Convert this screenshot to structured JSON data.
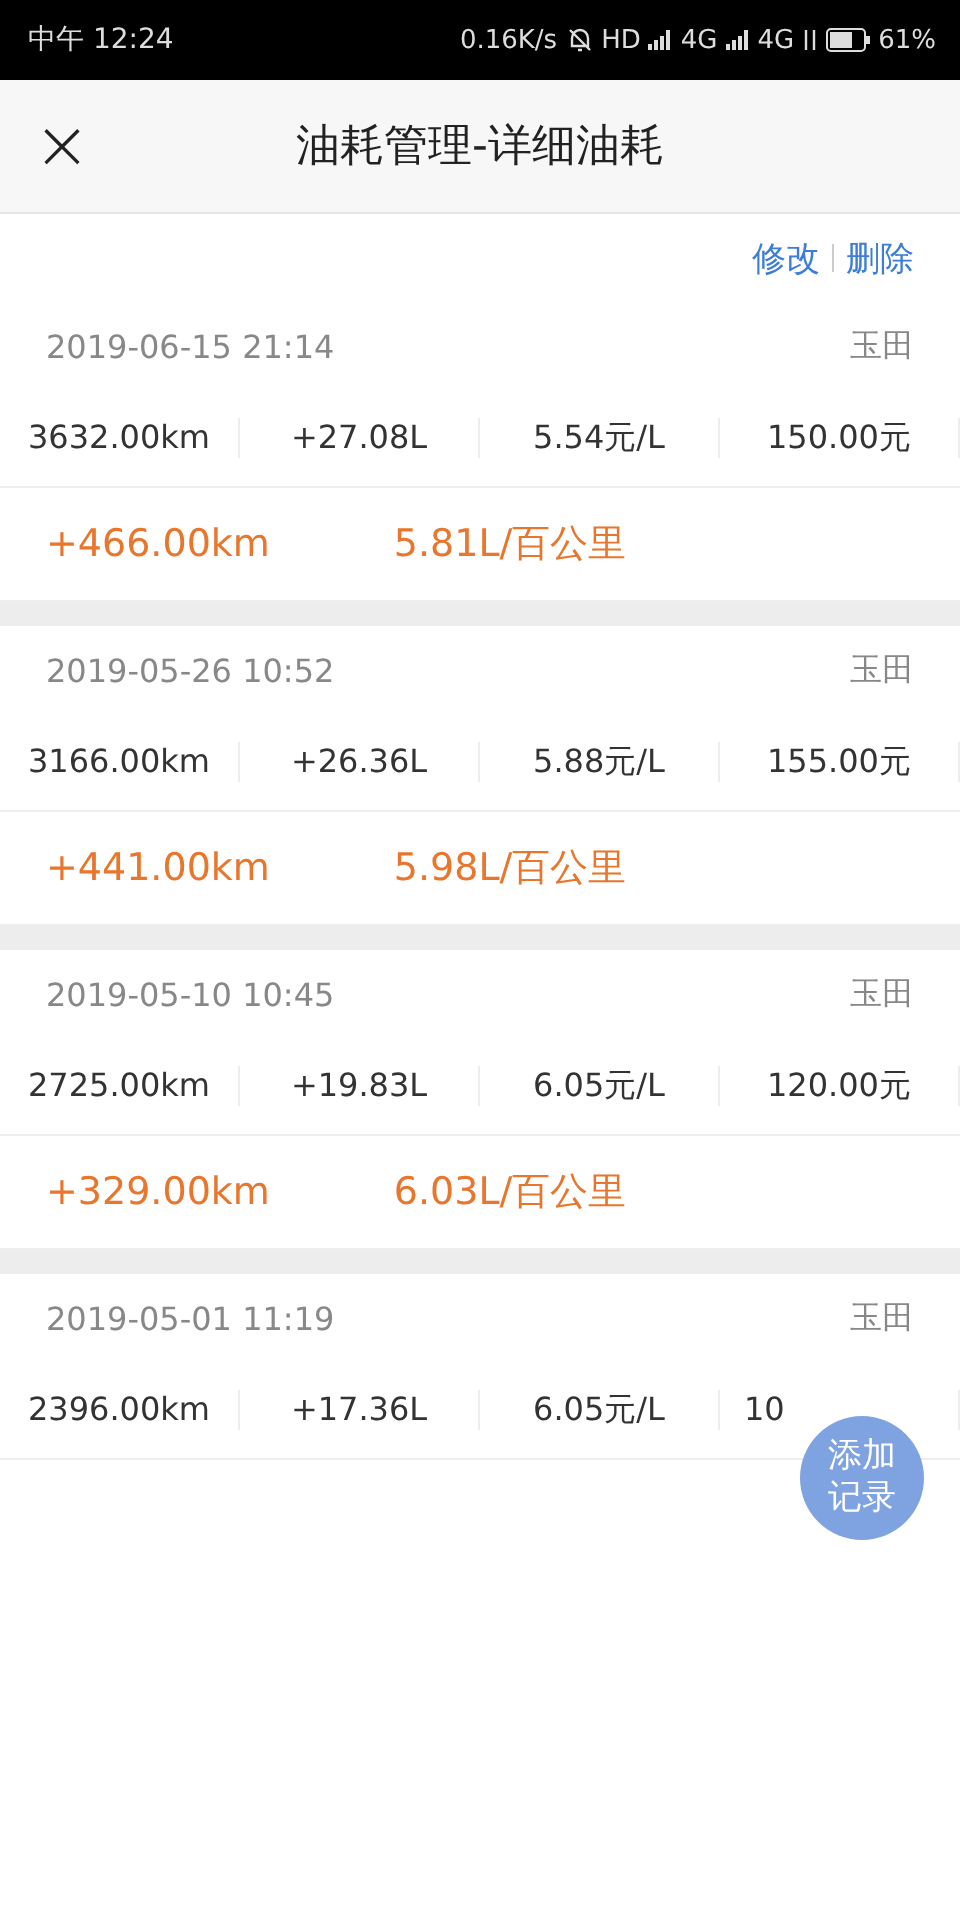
{
  "status_bar": {
    "time": "中午 12:24",
    "speed": "0.16K/s",
    "hd": "HD",
    "network_1": "4G",
    "network_2": "4G",
    "battery": "61%"
  },
  "header": {
    "close": "×",
    "title": "油耗管理-详细油耗"
  },
  "actions": [
    "修改",
    "删除"
  ],
  "records": [
    {
      "date": "2019-06-15 21:14",
      "location": "玉田",
      "values": [
        "3632.00km",
        "+27.08L",
        "5.54元/L",
        "150.00元"
      ],
      "stats": [
        "+466.00km",
        "5.81L/百公里"
      ]
    },
    {
      "date": "2019-05-26 10:52",
      "location": "玉田",
      "values": [
        "3166.00km",
        "+26.36L",
        "5.88元/L",
        "155.00元"
      ],
      "stats": [
        "+441.00km",
        "5.98L/百公里"
      ]
    },
    {
      "date": "2019-05-10 10:45",
      "location": "玉田",
      "values": [
        "2725.00km",
        "+19.83L",
        "6.05元/L",
        "120.00元"
      ],
      "stats": [
        "+329.00km",
        "6.03L/百公里"
      ]
    },
    {
      "date": "2019-05-01 11:19",
      "location": "玉田",
      "values": [
        "2396.00km",
        "+17.36L",
        "6.05元/L",
        "10"
      ]
    }
  ],
  "fab": {
    "line_1": "添加",
    "line_2": "记录"
  }
}
